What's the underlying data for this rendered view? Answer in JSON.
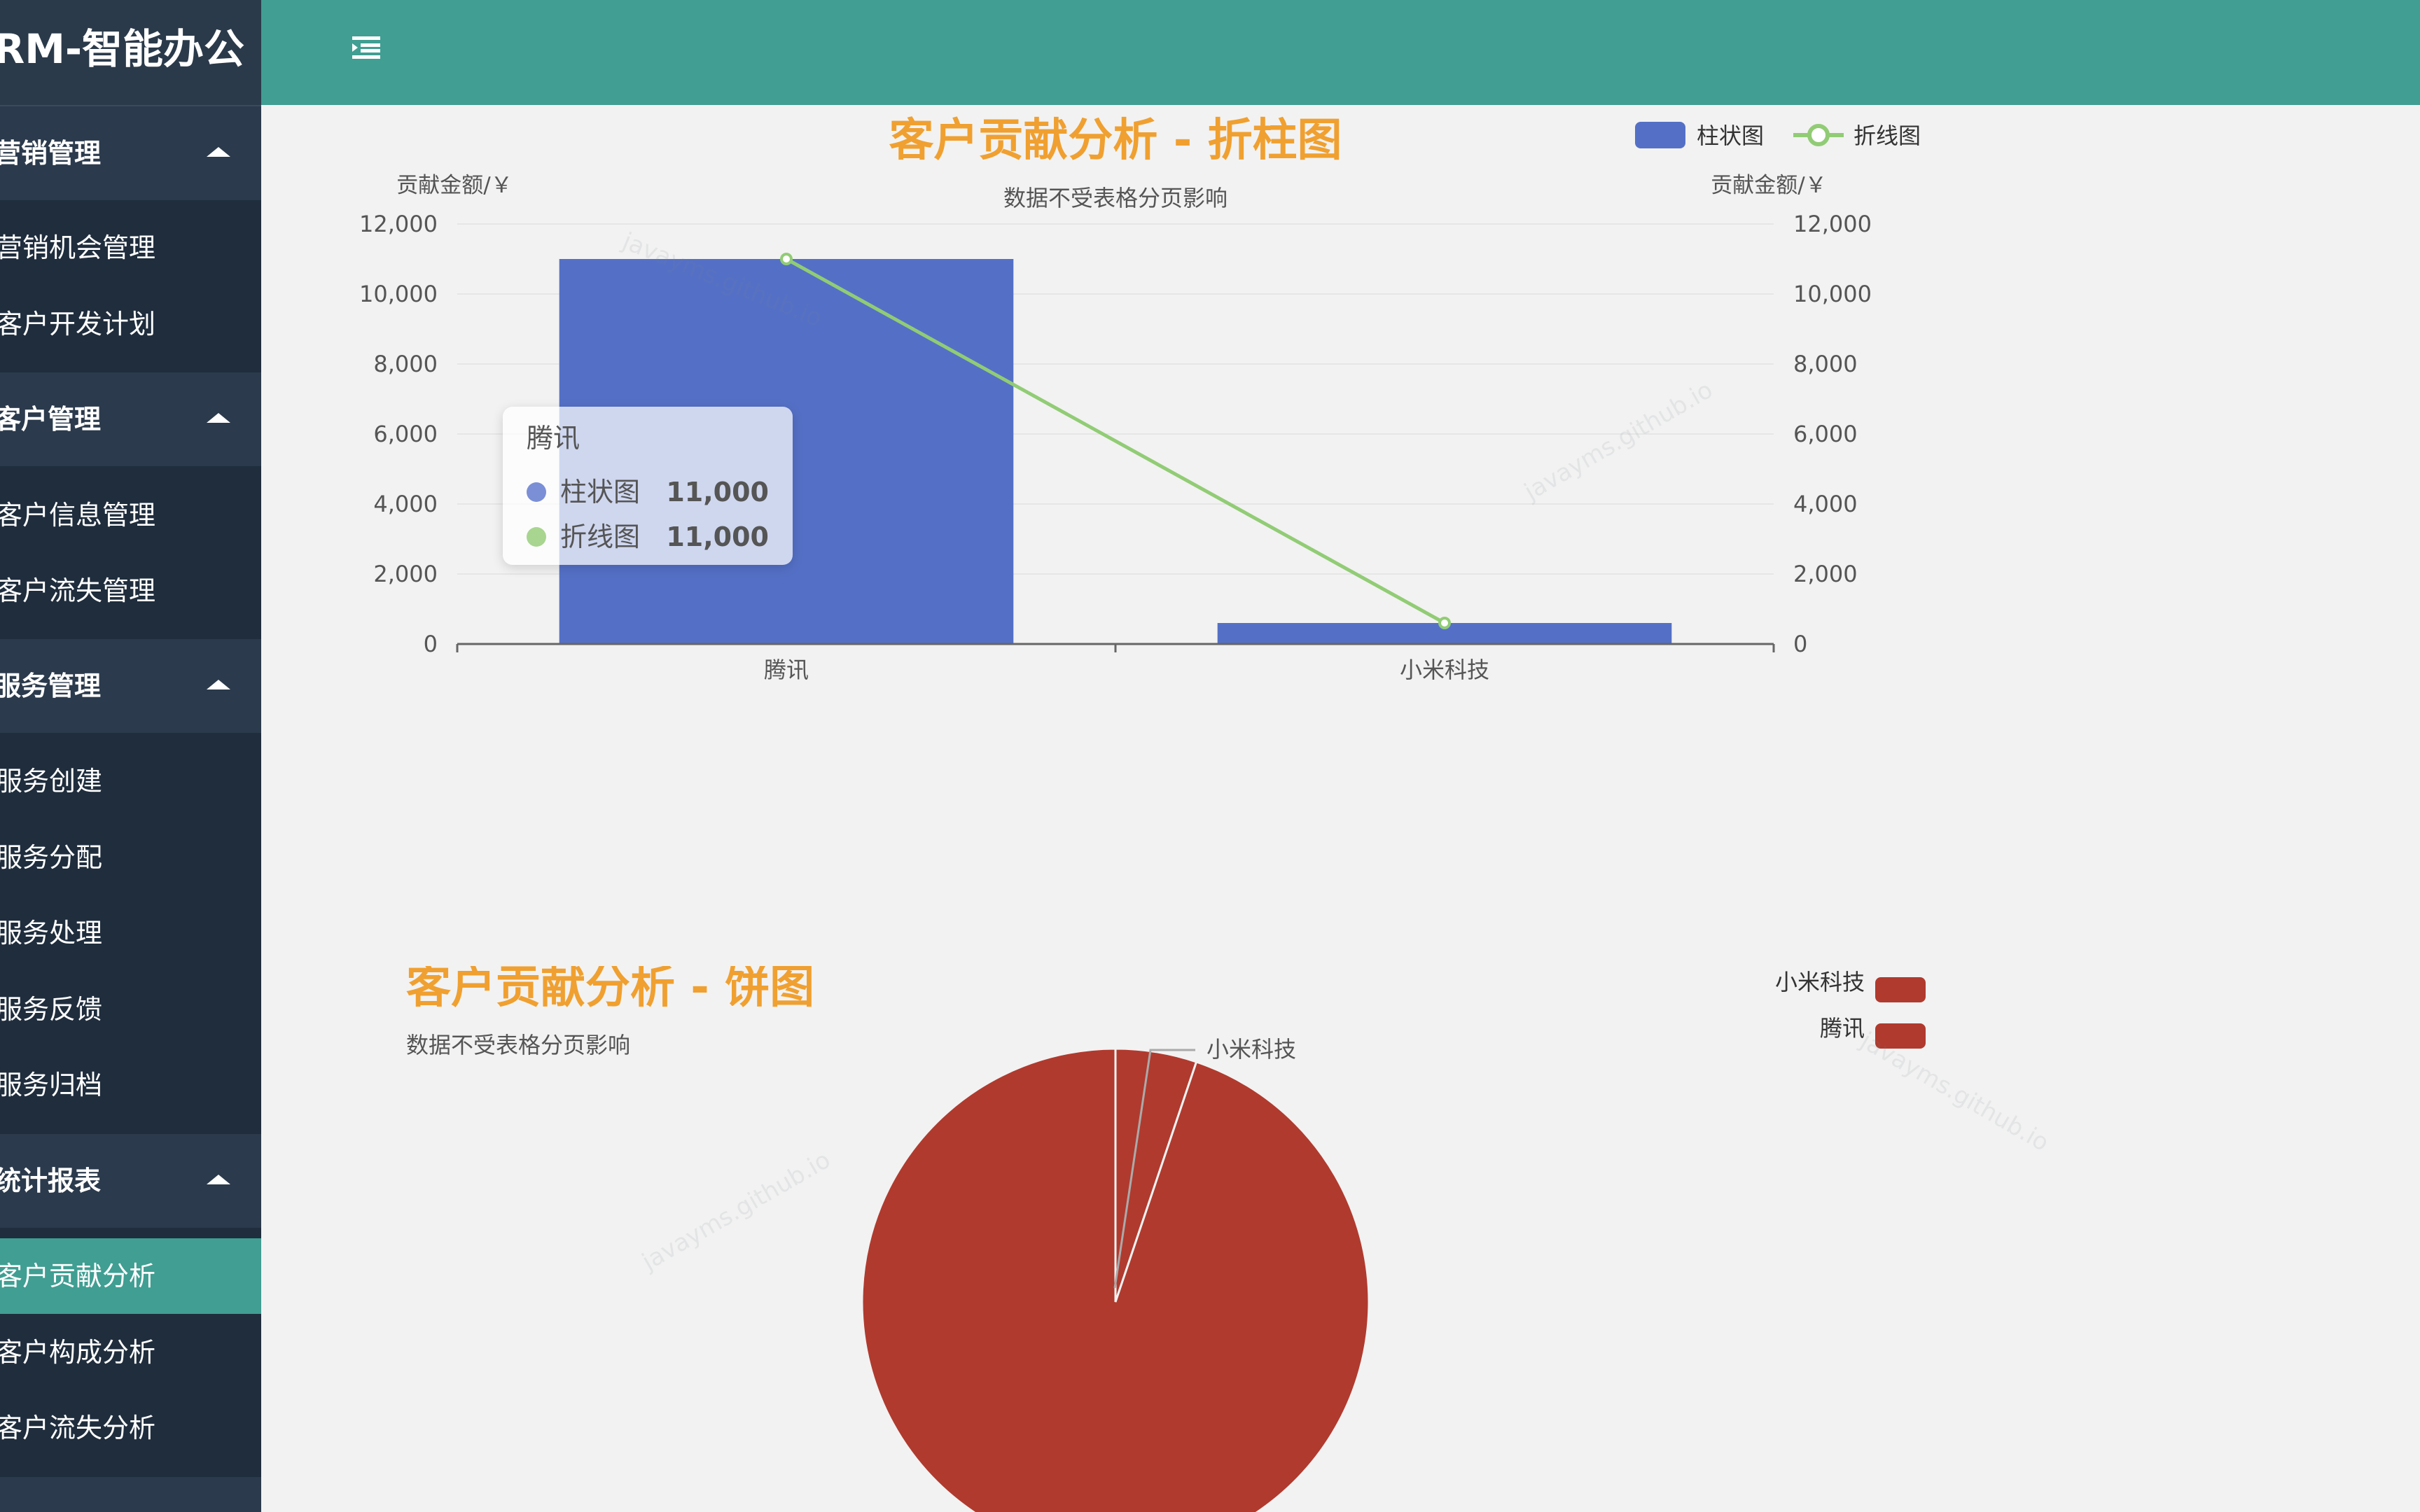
{
  "sidebar": {
    "brand": "CRM-智能办公",
    "groups": [
      {
        "title": "营销管理",
        "items": [
          "营销机会管理",
          "客户开发计划"
        ]
      },
      {
        "title": "客户管理",
        "items": [
          "客户信息管理",
          "客户流失管理"
        ]
      },
      {
        "title": "服务管理",
        "items": [
          "服务创建",
          "服务分配",
          "服务处理",
          "服务反馈",
          "服务归档"
        ]
      },
      {
        "title": "统计报表",
        "items": [
          "客户贡献分析",
          "客户构成分析",
          "客户流失分析"
        ]
      }
    ],
    "active_item": "客户贡献分析"
  },
  "header": {
    "menu_icon": "menu-fold-icon"
  },
  "watermark": "javayms.github.io",
  "colors": {
    "topbar": "#409e92",
    "sidebar": "#1f2d3d",
    "title": "#f0a030",
    "bar": "#5470c6",
    "line": "#91cc75",
    "pie": "#b03a2e"
  },
  "chart_data": [
    {
      "type": "bar",
      "title": "客户贡献分析 - 折柱图",
      "subtitle": "数据不受表格分页影响",
      "categories": [
        "腾讯",
        "小米科技"
      ],
      "series": [
        {
          "name": "柱状图",
          "type": "bar",
          "values": [
            11000,
            600
          ]
        },
        {
          "name": "折线图",
          "type": "line",
          "values": [
            11000,
            600
          ]
        }
      ],
      "ylabel": "贡献金额/￥",
      "ylabel_right": "贡献金额/￥",
      "ylim": [
        0,
        12000
      ],
      "yticks": [
        "0",
        "2,000",
        "4,000",
        "6,000",
        "8,000",
        "10,000",
        "12,000"
      ],
      "legend": "top-right",
      "tooltip": {
        "title": "腾讯",
        "rows": [
          {
            "name": "柱状图",
            "value": "11,000"
          },
          {
            "name": "折线图",
            "value": "11,000"
          }
        ]
      }
    },
    {
      "type": "pie",
      "title": "客户贡献分析 - 饼图",
      "subtitle": "数据不受表格分页影响",
      "slices": [
        {
          "name": "小米科技",
          "value": 600
        },
        {
          "name": "腾讯",
          "value": 11000
        }
      ],
      "callout_label": "小米科技",
      "legend": "top-right"
    }
  ]
}
